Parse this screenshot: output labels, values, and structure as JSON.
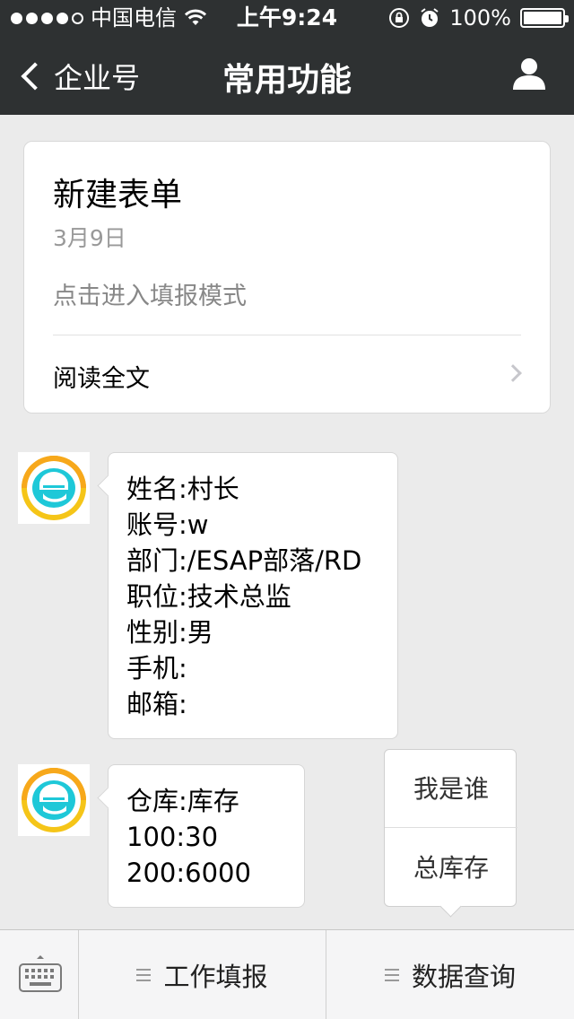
{
  "status_bar": {
    "carrier": "中国电信",
    "time": "上午9:24",
    "battery": "100%"
  },
  "nav": {
    "back_label": "企业号",
    "title": "常用功能"
  },
  "article": {
    "title": "新建表单",
    "date": "3月9日",
    "description": "点击进入填报模式",
    "read_more": "阅读全文"
  },
  "messages": [
    {
      "lines": [
        "姓名:村长",
        "账号:w",
        "部门:/ESAP部落/RD",
        "职位:技术总监",
        "性别:男",
        "手机:",
        "邮箱:"
      ]
    },
    {
      "lines": [
        "仓库:库存",
        "100:30",
        "200:6000"
      ]
    }
  ],
  "popup_menu": {
    "items": [
      "我是谁",
      "总库存"
    ]
  },
  "bottom_menu": {
    "items": [
      "工作填报",
      "数据查询"
    ]
  },
  "colors": {
    "nav_background": "#2e3132",
    "page_background": "#ebebeb",
    "avatar_yellow": "#f5c518",
    "avatar_cyan": "#1ec8d8"
  }
}
